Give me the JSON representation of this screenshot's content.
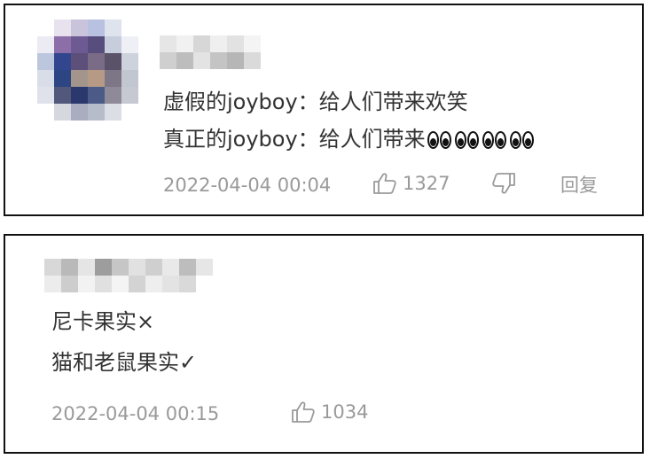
{
  "comments": [
    {
      "lines": [
        "虚假的joyboy：给人们带来欢笑",
        "真正的joyboy：给人们带来"
      ],
      "emoji_icon": "eyes-emoji",
      "emoji_count": 4,
      "timestamp": "2022-04-04 00:04",
      "likes": "1327",
      "reply_label": "回复",
      "avatar_icon": "pixelated-avatar",
      "username_icon": "pixelated-username"
    },
    {
      "lines": [
        "尼卡果实×",
        "猫和老鼠果实✓"
      ],
      "timestamp": "2022-04-04 00:15",
      "likes": "1034",
      "username_icon": "pixelated-username"
    }
  ],
  "icons": {
    "like": "thumbs-up-icon",
    "dislike": "thumbs-down-icon"
  },
  "colors": {
    "text": "#333333",
    "meta": "#9a9a9a",
    "border": "#111111"
  }
}
